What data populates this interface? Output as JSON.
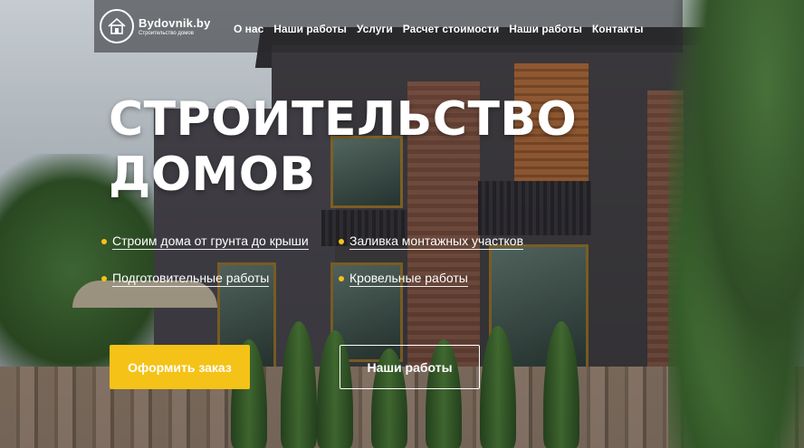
{
  "brand": {
    "name": "Bydovnik.by",
    "tagline": "Строительство домов",
    "logo_icon": "house-icon"
  },
  "nav": {
    "items": [
      {
        "label": "О нас"
      },
      {
        "label": "Наши работы"
      },
      {
        "label": "Услуги"
      },
      {
        "label": "Расчет стоимости"
      },
      {
        "label": "Наши работы"
      },
      {
        "label": "Контакты"
      }
    ]
  },
  "hero": {
    "title_line1": "СТРОИТЕЛЬСТВО",
    "title_line2": "ДОМОВ",
    "features": [
      {
        "label": "Строим дома от грунта до крыши"
      },
      {
        "label": "Заливка монтажных участков"
      },
      {
        "label": "Подготовительные работы"
      },
      {
        "label": "Кровельные работы"
      }
    ],
    "order_button": "Оформить заказ",
    "works_button": "Наши работы"
  },
  "colors": {
    "accent": "#f5c218",
    "text": "#ffffff"
  }
}
